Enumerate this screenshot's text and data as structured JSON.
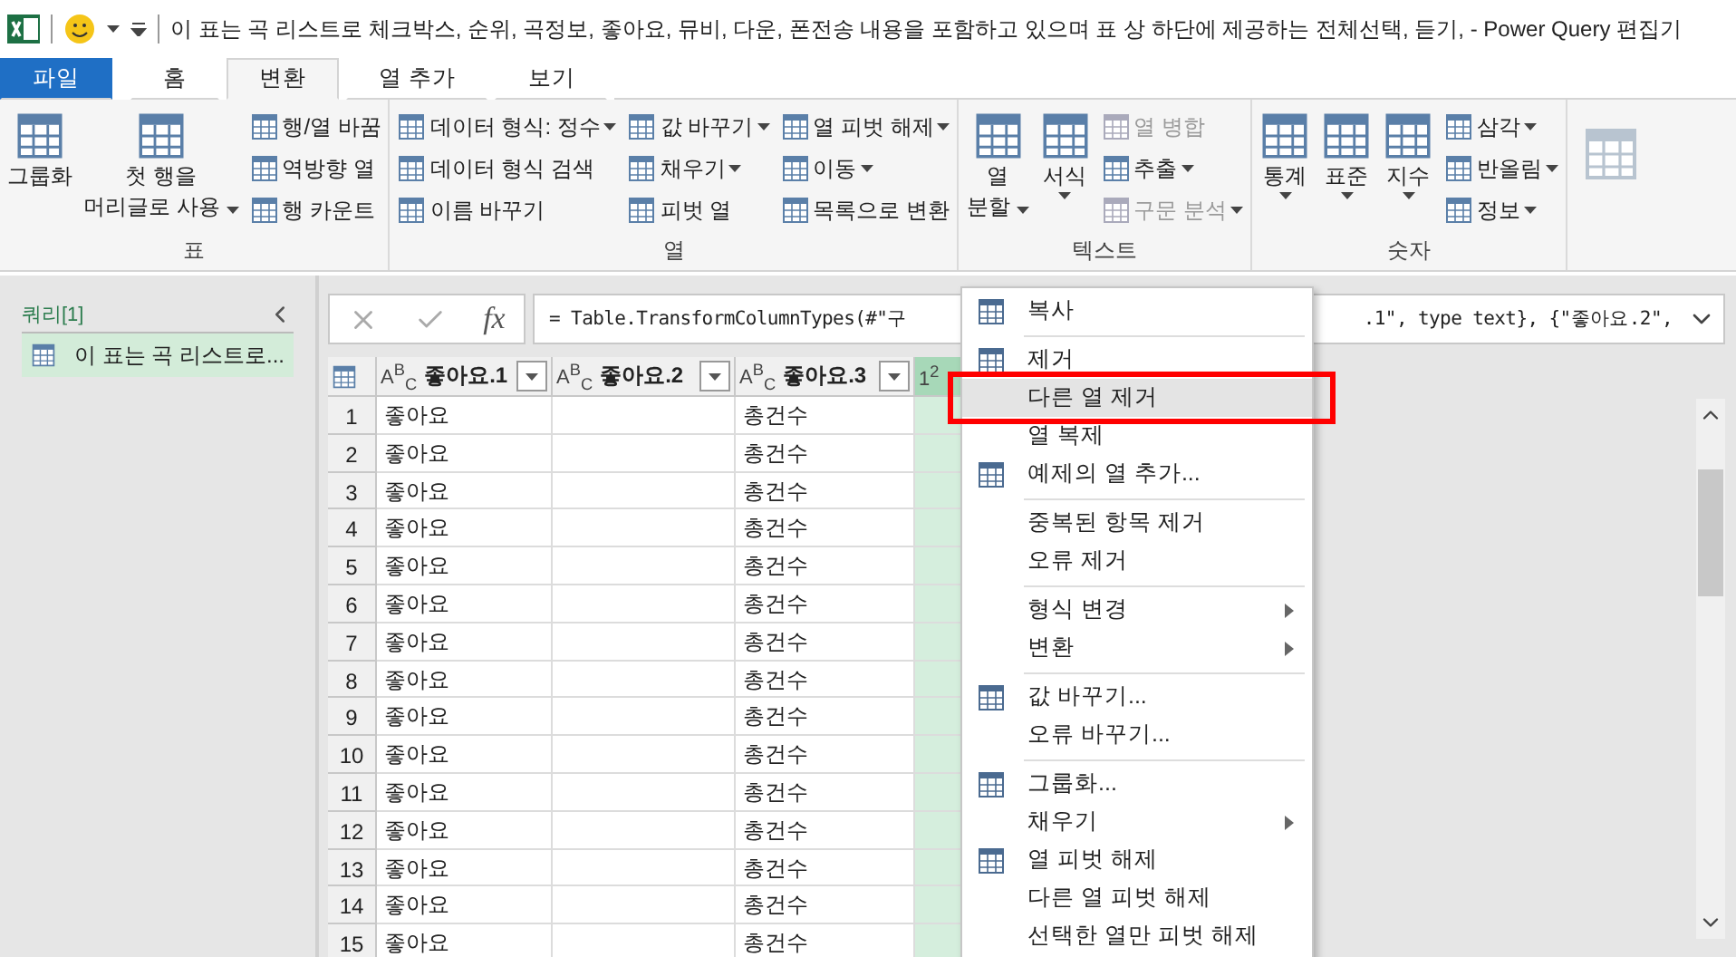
{
  "title_bar": {
    "title": "이 표는 곡 리스트로 체크박스, 순위, 곡정보, 좋아요, 뮤비, 다운, 폰전송 내용을 포함하고 있으며 표 상 하단에 제공하는 전체선택, 듣기, - Power Query 편집기"
  },
  "ribbon_tabs": [
    {
      "label": "파일",
      "kind": "file",
      "selected": false
    },
    {
      "label": "홈",
      "kind": "tab",
      "selected": false
    },
    {
      "label": "변환",
      "kind": "tab",
      "selected": true
    },
    {
      "label": "열 추가",
      "kind": "tab",
      "selected": false
    },
    {
      "label": "보기",
      "kind": "tab",
      "selected": false
    }
  ],
  "ribbon_groups": [
    {
      "label": "표",
      "columns": [
        {
          "kind": "large",
          "buttons": [
            {
              "lines": [
                "그룹화"
              ],
              "dropdown": false,
              "disabled": false
            }
          ]
        },
        {
          "kind": "large",
          "buttons": [
            {
              "lines": [
                "첫 행을",
                "머리글로 사용"
              ],
              "dropdown": true,
              "disabled": false
            }
          ]
        },
        {
          "kind": "stack",
          "buttons": [
            {
              "lines": [
                "행/열 바꿈"
              ],
              "dropdown": false,
              "disabled": false
            },
            {
              "lines": [
                "역방향 열"
              ],
              "dropdown": false,
              "disabled": false
            },
            {
              "lines": [
                "행 카운트"
              ],
              "dropdown": false,
              "disabled": false
            }
          ]
        }
      ]
    },
    {
      "label": "열",
      "columns": [
        {
          "kind": "stack",
          "buttons": [
            {
              "lines": [
                "데이터 형식: 정수"
              ],
              "dropdown": true,
              "disabled": false
            },
            {
              "lines": [
                "데이터 형식 검색"
              ],
              "dropdown": false,
              "disabled": false
            },
            {
              "lines": [
                "이름 바꾸기"
              ],
              "dropdown": false,
              "disabled": false
            }
          ]
        },
        {
          "kind": "stack",
          "buttons": [
            {
              "lines": [
                "값 바꾸기"
              ],
              "dropdown": true,
              "disabled": false
            },
            {
              "lines": [
                "채우기"
              ],
              "dropdown": true,
              "disabled": false
            },
            {
              "lines": [
                "피벗 열"
              ],
              "dropdown": false,
              "disabled": false
            }
          ]
        },
        {
          "kind": "stack",
          "buttons": [
            {
              "lines": [
                "열 피벗 해제"
              ],
              "dropdown": true,
              "disabled": false
            },
            {
              "lines": [
                "이동"
              ],
              "dropdown": true,
              "disabled": false
            },
            {
              "lines": [
                "목록으로 변환"
              ],
              "dropdown": false,
              "disabled": false
            }
          ]
        }
      ]
    },
    {
      "label": "텍스트",
      "columns": [
        {
          "kind": "large",
          "buttons": [
            {
              "lines": [
                "열",
                "분할"
              ],
              "dropdown": true,
              "disabled": false
            }
          ]
        },
        {
          "kind": "large",
          "buttons": [
            {
              "lines": [
                "서식"
              ],
              "dropdown": true,
              "disabled": false
            }
          ]
        },
        {
          "kind": "stack",
          "buttons": [
            {
              "lines": [
                "열 병합"
              ],
              "dropdown": false,
              "disabled": true
            },
            {
              "lines": [
                "추출"
              ],
              "dropdown": true,
              "disabled": false
            },
            {
              "lines": [
                "구문 분석"
              ],
              "dropdown": true,
              "disabled": true
            }
          ]
        }
      ]
    },
    {
      "label": "숫자",
      "columns": [
        {
          "kind": "large",
          "buttons": [
            {
              "lines": [
                "통계"
              ],
              "dropdown": true,
              "disabled": false
            }
          ]
        },
        {
          "kind": "large",
          "buttons": [
            {
              "lines": [
                "표준"
              ],
              "dropdown": true,
              "disabled": false
            }
          ]
        },
        {
          "kind": "large",
          "buttons": [
            {
              "lines": [
                "지수"
              ],
              "dropdown": true,
              "disabled": false
            }
          ]
        },
        {
          "kind": "stack",
          "buttons": [
            {
              "lines": [
                "삼각"
              ],
              "dropdown": true,
              "disabled": false
            },
            {
              "lines": [
                "반올림"
              ],
              "dropdown": true,
              "disabled": false
            },
            {
              "lines": [
                "정보"
              ],
              "dropdown": true,
              "disabled": false
            }
          ]
        }
      ]
    }
  ],
  "queries": {
    "header": "쿼리[1]",
    "items": [
      {
        "label": "이 표는 곡 리스트로...",
        "selected": true
      }
    ]
  },
  "formula_bar": {
    "fx": "fx",
    "text_start": "= Table.TransformColumnTypes(#\"구",
    "text_end": ".1\", type text}, {\"좋아요.2\","
  },
  "table": {
    "columns": [
      {
        "type": "A$^{B}$$_{C}$",
        "name": "좋아요.1",
        "selected": false
      },
      {
        "type": "A$^{B}$$_{C}$",
        "name": "좋아요.2",
        "selected": false
      },
      {
        "type": "A$^{B}$$_{C}$",
        "name": "좋아요.3",
        "selected": false
      },
      {
        "type": "1$^{2}$",
        "selected": true
      }
    ],
    "rows": [
      {
        "n": "1",
        "cells": [
          "좋아요",
          null,
          "총건수"
        ]
      },
      {
        "n": "2",
        "cells": [
          "좋아요",
          null,
          "총건수"
        ]
      },
      {
        "n": "3",
        "cells": [
          "좋아요",
          null,
          "총건수"
        ]
      },
      {
        "n": "4",
        "cells": [
          "좋아요",
          null,
          "총건수"
        ]
      },
      {
        "n": "5",
        "cells": [
          "좋아요",
          null,
          "총건수"
        ]
      },
      {
        "n": "6",
        "cells": [
          "좋아요",
          null,
          "총건수"
        ]
      },
      {
        "n": "7",
        "cells": [
          "좋아요",
          null,
          "총건수"
        ]
      },
      {
        "n": "8",
        "cells": [
          "좋아요",
          null,
          "총건수"
        ]
      },
      {
        "n": "9",
        "cells": [
          "좋아요",
          null,
          "총건수"
        ]
      },
      {
        "n": "10",
        "cells": [
          "좋아요",
          null,
          "총건수"
        ]
      },
      {
        "n": "11",
        "cells": [
          "좋아요",
          null,
          "총건수"
        ]
      },
      {
        "n": "12",
        "cells": [
          "좋아요",
          null,
          "총건수"
        ]
      },
      {
        "n": "13",
        "cells": [
          "좋아요",
          null,
          "총건수"
        ]
      },
      {
        "n": "14",
        "cells": [
          "좋아요",
          null,
          "총건수"
        ]
      },
      {
        "n": "15",
        "cells": [
          "좋아요",
          null,
          "총건수"
        ]
      }
    ]
  },
  "context_menu": {
    "items": [
      {
        "kind": "item",
        "label": "복사",
        "icon": true,
        "submenu": false,
        "hovered": false,
        "highlighted": false
      },
      {
        "kind": "separator"
      },
      {
        "kind": "item",
        "label": "제거",
        "icon": true,
        "submenu": false,
        "hovered": false,
        "highlighted": false
      },
      {
        "kind": "item",
        "label": "다른 열 제거",
        "icon": false,
        "submenu": false,
        "hovered": true,
        "highlighted": true
      },
      {
        "kind": "item",
        "label": "열 복제",
        "icon": false,
        "submenu": false,
        "hovered": false,
        "highlighted": false
      },
      {
        "kind": "item",
        "label": "예제의 열 추가...",
        "icon": true,
        "submenu": false,
        "hovered": false,
        "highlighted": false
      },
      {
        "kind": "separator"
      },
      {
        "kind": "item",
        "label": "중복된 항목 제거",
        "icon": false,
        "submenu": false,
        "hovered": false,
        "highlighted": false
      },
      {
        "kind": "item",
        "label": "오류 제거",
        "icon": false,
        "submenu": false,
        "hovered": false,
        "highlighted": false
      },
      {
        "kind": "separator"
      },
      {
        "kind": "item",
        "label": "형식 변경",
        "icon": false,
        "submenu": true,
        "hovered": false,
        "highlighted": false
      },
      {
        "kind": "item",
        "label": "변환",
        "icon": false,
        "submenu": true,
        "hovered": false,
        "highlighted": false
      },
      {
        "kind": "separator"
      },
      {
        "kind": "item",
        "label": "값 바꾸기...",
        "icon": true,
        "submenu": false,
        "hovered": false,
        "highlighted": false
      },
      {
        "kind": "item",
        "label": "오류 바꾸기...",
        "icon": false,
        "submenu": false,
        "hovered": false,
        "highlighted": false
      },
      {
        "kind": "separator"
      },
      {
        "kind": "item",
        "label": "그룹화...",
        "icon": true,
        "submenu": false,
        "hovered": false,
        "highlighted": false
      },
      {
        "kind": "item",
        "label": "채우기",
        "icon": false,
        "submenu": true,
        "hovered": false,
        "highlighted": false
      },
      {
        "kind": "item",
        "label": "열 피벗 해제",
        "icon": true,
        "submenu": false,
        "hovered": false,
        "highlighted": false
      },
      {
        "kind": "item",
        "label": "다른 열 피벗 해제",
        "icon": false,
        "submenu": false,
        "hovered": false,
        "highlighted": false
      },
      {
        "kind": "item",
        "label": "선택한 열만 피벗 해제",
        "icon": false,
        "submenu": false,
        "hovered": false,
        "highlighted": false
      }
    ]
  }
}
